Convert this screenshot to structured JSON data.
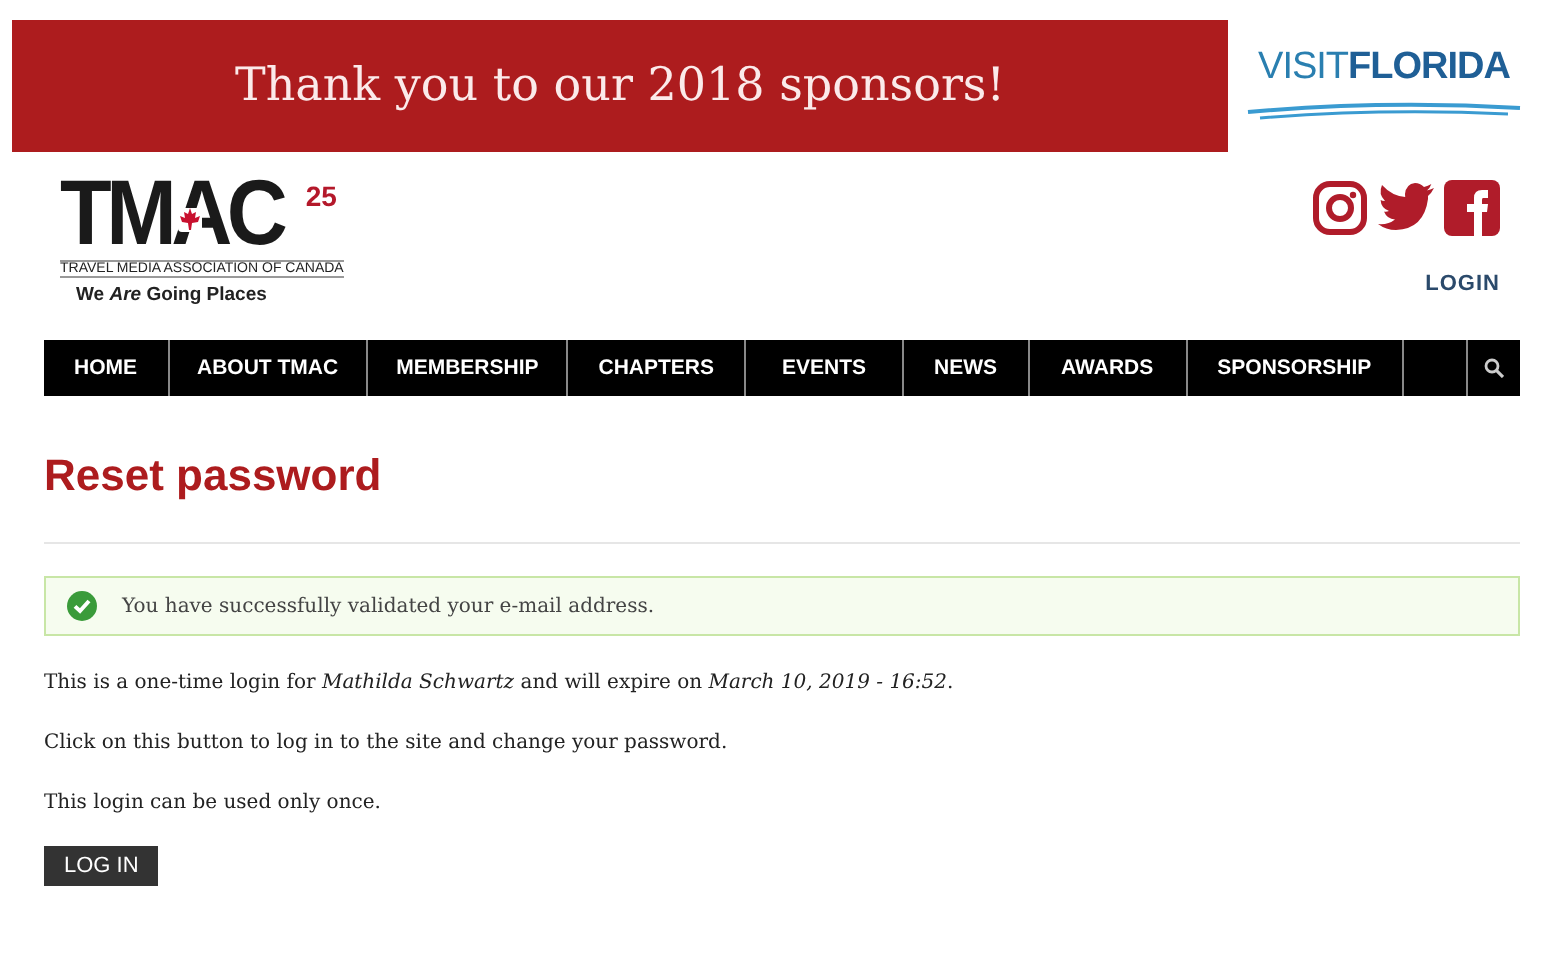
{
  "banner": {
    "text": "Thank you to our 2018 sponsors!",
    "sponsor": {
      "part_1": "VISIT",
      "part_2": "FLORIDA"
    }
  },
  "logo": {
    "wordmark": "TMAC",
    "anniversary": "25",
    "name": "TRAVEL MEDIA ASSOCIATION OF CANADA",
    "tagline": "We *Are* Going Places"
  },
  "header": {
    "login": "LOGIN"
  },
  "nav": {
    "items": [
      {
        "label": "HOME",
        "selected": false
      },
      {
        "label": "ABOUT TMAC",
        "selected": false
      },
      {
        "label": "MEMBERSHIP",
        "selected": false
      },
      {
        "label": "CHAPTERS",
        "selected": false
      },
      {
        "label": "EVENTS",
        "selected": false
      },
      {
        "label": "NEWS",
        "selected": false
      },
      {
        "label": "AWARDS",
        "selected": false
      },
      {
        "label": "SPONSORSHIP",
        "selected": false
      }
    ]
  },
  "page": {
    "title": "Reset password",
    "message": {
      "kind": "success",
      "text": "You have successfully validated your e-mail address."
    },
    "paragraphs": [
      "This is a one-time login for *Mathilda Schwartz* and will expire on *March 10, 2019 - 16:52*.",
      "Click on this button to log in to the site and change your password.",
      "This login can be used only once."
    ],
    "button": "LOG IN"
  }
}
